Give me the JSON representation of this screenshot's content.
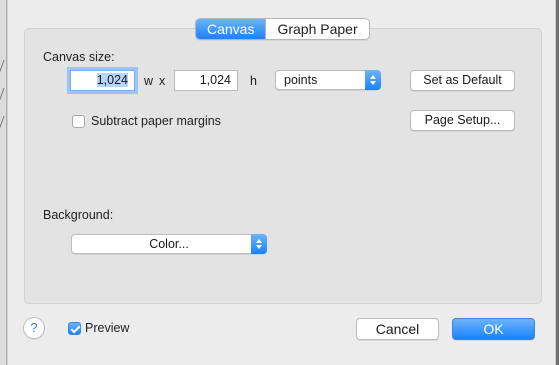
{
  "tabs": [
    {
      "label": "Canvas",
      "active": true
    },
    {
      "label": "Graph Paper",
      "active": false
    }
  ],
  "canvas_size": {
    "label": "Canvas size:",
    "width": "1,024",
    "width_unit": "w",
    "times": "x",
    "height": "1,024",
    "height_unit": "h",
    "units": "points",
    "set_default_label": "Set as Default"
  },
  "subtract_margins": {
    "label": "Subtract paper margins",
    "checked": false
  },
  "page_setup_label": "Page Setup...",
  "background": {
    "label": "Background:",
    "value": "Color..."
  },
  "footer": {
    "help_glyph": "?",
    "preview_label": "Preview",
    "preview_checked": true,
    "cancel_label": "Cancel",
    "ok_label": "OK"
  },
  "colors": {
    "accent": "#1a82fb",
    "sheet_bg": "#ececec"
  }
}
